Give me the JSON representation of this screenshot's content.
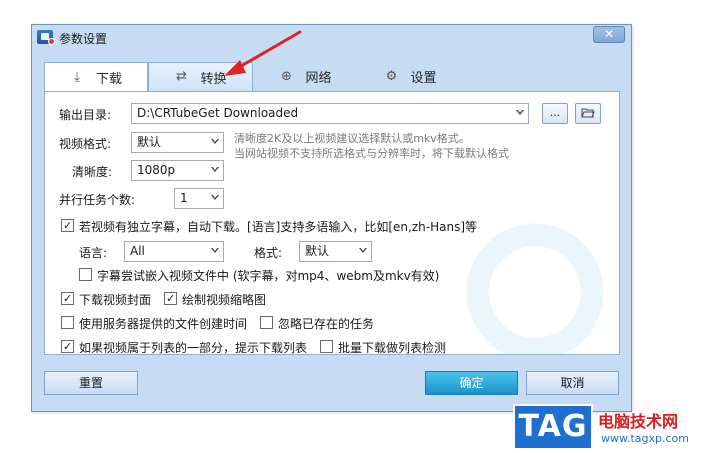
{
  "window": {
    "title": "参数设置",
    "close_symbol": "✕"
  },
  "tabs": [
    {
      "label": "下载",
      "icon": "download-icon",
      "glyph": "⤓"
    },
    {
      "label": "转换",
      "icon": "convert-icon",
      "glyph": "⇄"
    },
    {
      "label": "网络",
      "icon": "globe-icon",
      "glyph": "⊕"
    },
    {
      "label": "设置",
      "icon": "gear-icon",
      "glyph": "⚙"
    }
  ],
  "form": {
    "output_dir_label": "输出目录:",
    "output_dir_value": "D:\\CRTubeGet Downloaded",
    "browse_label": "...",
    "folder_icon": "folder-open-icon",
    "video_format_label": "视频格式:",
    "video_format_value": "默认",
    "resolution_label": "清晰度:",
    "resolution_value": "1080p",
    "hint_line1": "清晰度2K及以上视频建议选择默认或mkv格式。",
    "hint_line2": "当网站视频不支持所选格式与分辨率时，将下载默认格式",
    "parallel_label": "并行任务个数:",
    "parallel_value": "1",
    "subtitle_check_label": "若视频有独立字幕，自动下载。[语言]支持多语输入，比如[en,zh-Hans]等",
    "language_label": "语言:",
    "language_value": "All",
    "sub_format_label": "格式:",
    "sub_format_value": "默认",
    "embed_sub_label": "字幕尝试嵌入视频文件中 (软字幕，对mp4、webm及mkv有效)",
    "cover_label": "下载视频封面",
    "thumbnail_label": "绘制视频缩略图",
    "server_time_label": "使用服务器提供的文件创建时间",
    "ignore_exist_label": "忽略已存在的任务",
    "playlist_prompt_label": "如果视频属于列表的一部分，提示下载列表",
    "batch_playlist_label": "批量下载做列表检测"
  },
  "checks": {
    "subtitle": true,
    "embed_sub": false,
    "cover": true,
    "thumbnail": true,
    "server_time": false,
    "ignore_exist": false,
    "playlist_prompt": true,
    "batch_playlist": false
  },
  "buttons": {
    "reset": "重置",
    "ok": "确定",
    "cancel": "取消"
  },
  "watermark": {
    "badge": "TAG",
    "site_name": "电脑技术网",
    "site_url": "www.tagxp.com"
  },
  "colors": {
    "window_bg": "#c6dcf2",
    "primary_button": "#1795cf",
    "annotation_arrow": "#e02424"
  }
}
